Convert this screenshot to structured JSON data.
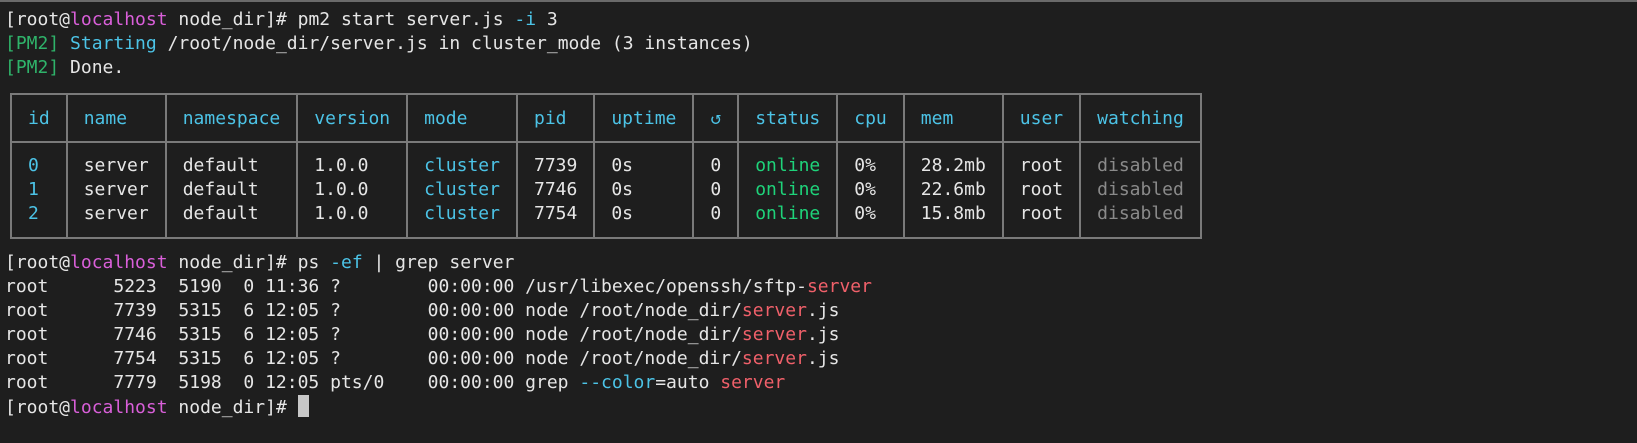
{
  "prompt": {
    "open": "[root@",
    "host": "localhost",
    "close": " node_dir]# "
  },
  "cmd1": {
    "name": "pm2 start server.js ",
    "flag": "-i",
    "arg": " 3"
  },
  "pm2_lines": [
    {
      "tag": "[PM2]",
      "label": "Starting",
      "text": " /root/node_dir/server.js in cluster_mode (3 instances)"
    },
    {
      "tag": "[PM2]",
      "label": "",
      "text": " Done."
    }
  ],
  "table": {
    "headers": [
      "id",
      "name",
      "namespace",
      "version",
      "mode",
      "pid",
      "uptime",
      "↺",
      "status",
      "cpu",
      "mem",
      "user",
      "watching"
    ],
    "rows": [
      {
        "id": "0",
        "name": "server",
        "namespace": "default",
        "version": "1.0.0",
        "mode": "cluster",
        "pid": "7739",
        "uptime": "0s",
        "restarts": "0",
        "status": "online",
        "cpu": "0%",
        "mem": "28.2mb",
        "user": "root",
        "watching": "disabled"
      },
      {
        "id": "1",
        "name": "server",
        "namespace": "default",
        "version": "1.0.0",
        "mode": "cluster",
        "pid": "7746",
        "uptime": "0s",
        "restarts": "0",
        "status": "online",
        "cpu": "0%",
        "mem": "22.6mb",
        "user": "root",
        "watching": "disabled"
      },
      {
        "id": "2",
        "name": "server",
        "namespace": "default",
        "version": "1.0.0",
        "mode": "cluster",
        "pid": "7754",
        "uptime": "0s",
        "restarts": "0",
        "status": "online",
        "cpu": "0%",
        "mem": "15.8mb",
        "user": "root",
        "watching": "disabled"
      }
    ]
  },
  "cmd2": {
    "a": "ps ",
    "flag": "-ef",
    "b": " | grep server"
  },
  "ps_lines": [
    {
      "prefix": "root      5223  5190  0 11:36 ?        00:00:00 /usr/libexec/openssh/sftp-",
      "match": "server",
      "suffix": ""
    },
    {
      "prefix": "root      7739  5315  6 12:05 ?        00:00:00 node /root/node_dir/",
      "match": "server",
      "suffix": ".js"
    },
    {
      "prefix": "root      7746  5315  6 12:05 ?        00:00:00 node /root/node_dir/",
      "match": "server",
      "suffix": ".js"
    },
    {
      "prefix": "root      7754  5315  6 12:05 ?        00:00:00 node /root/node_dir/",
      "match": "server",
      "suffix": ".js"
    }
  ],
  "grep_line": {
    "prefix": "root      7779  5198  0 12:05 pts/0    00:00:00 grep ",
    "flag": "--color",
    "mid": "=auto ",
    "match": "server"
  },
  "colors": {
    "background": "#1e1e1e",
    "host": "#d95fd9",
    "accent": "#4cc3e6",
    "online": "#1ed37a",
    "grep_match": "#f0606a"
  }
}
